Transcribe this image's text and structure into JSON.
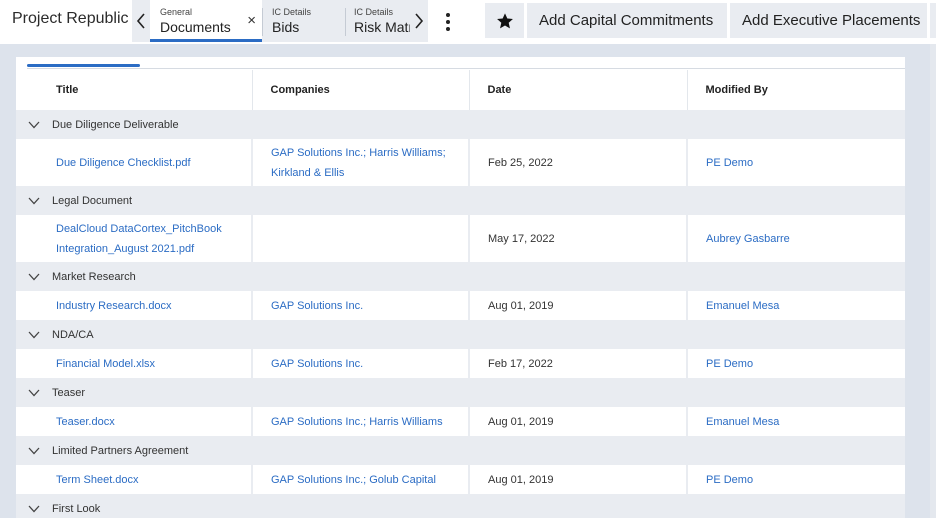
{
  "header": {
    "project_title": "Project Republic",
    "tabs": [
      {
        "sublabel": "General",
        "label": "Documents",
        "close": "×"
      },
      {
        "sublabel": "IC Details",
        "label": "Bids"
      },
      {
        "sublabel": "IC Details",
        "label": "Risk Matrix"
      }
    ],
    "quick_actions": [
      "Add Capital Commitments",
      "Add Executive Placements"
    ]
  },
  "table": {
    "columns": [
      "Title",
      "Companies",
      "Date",
      "Modified By"
    ],
    "groups": [
      {
        "name": "Due Diligence Deliverable",
        "rows": [
          {
            "title": "Due Diligence Checklist.pdf",
            "companies": "GAP Solutions Inc.; Harris Williams; Kirkland & Ellis",
            "date": "Feb 25, 2022",
            "modified_by": "PE Demo"
          }
        ]
      },
      {
        "name": "Legal Document",
        "rows": [
          {
            "title": "DealCloud DataCortex_PitchBook Integration_August 2021.pdf",
            "companies": "",
            "date": "May 17, 2022",
            "modified_by": "Aubrey Gasbarre"
          }
        ]
      },
      {
        "name": "Market Research",
        "rows": [
          {
            "title": "Industry Research.docx",
            "companies": "GAP Solutions Inc.",
            "date": "Aug 01, 2019",
            "modified_by": "Emanuel Mesa"
          }
        ]
      },
      {
        "name": "NDA/CA",
        "rows": [
          {
            "title": "Financial Model.xlsx",
            "companies": "GAP Solutions Inc.",
            "date": "Feb 17, 2022",
            "modified_by": "PE Demo"
          }
        ]
      },
      {
        "name": "Teaser",
        "rows": [
          {
            "title": "Teaser.docx",
            "companies": "GAP Solutions Inc.; Harris Williams",
            "date": "Aug 01, 2019",
            "modified_by": "Emanuel Mesa"
          }
        ]
      },
      {
        "name": "Limited Partners Agreement",
        "rows": [
          {
            "title": "Term Sheet.docx",
            "companies": "GAP Solutions Inc.; Golub Capital",
            "date": "Aug 01, 2019",
            "modified_by": "PE Demo"
          }
        ]
      },
      {
        "name": "First Look",
        "rows": []
      }
    ]
  },
  "icons": {
    "tab_prev": "chevron-left-icon",
    "tab_next": "chevron-right-icon",
    "more": "kebab-menu-icon",
    "favorite": "star-icon",
    "group_toggle": "chevron-down-icon"
  },
  "colors": {
    "accent": "#2b6cc4",
    "link": "#2b6cc4",
    "group_bg": "#e9ecf1",
    "page_bg": "#dde3ec"
  }
}
